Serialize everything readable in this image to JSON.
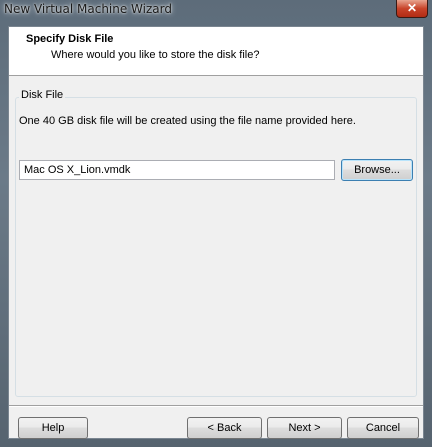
{
  "window": {
    "title": "New Virtual Machine Wizard",
    "close_label": "✕"
  },
  "header": {
    "title": "Specify Disk File",
    "subtitle": "Where would you like to store the disk file?"
  },
  "disk_file_group": {
    "label": "Disk File",
    "description": "One 40 GB disk file will be created using the file name provided here.",
    "file_name_value": "Mac OS X_Lion.vmdk",
    "browse_label": "Browse..."
  },
  "footer": {
    "help_label": "Help",
    "back_label": "< Back",
    "next_label": "Next >",
    "cancel_label": "Cancel"
  },
  "colors": {
    "frame": "#5d6c7a",
    "client_bg": "#f0f0f0",
    "header_bg": "#ffffff",
    "close_red": "#c8442a",
    "focus_blue": "#3c7fb1"
  }
}
